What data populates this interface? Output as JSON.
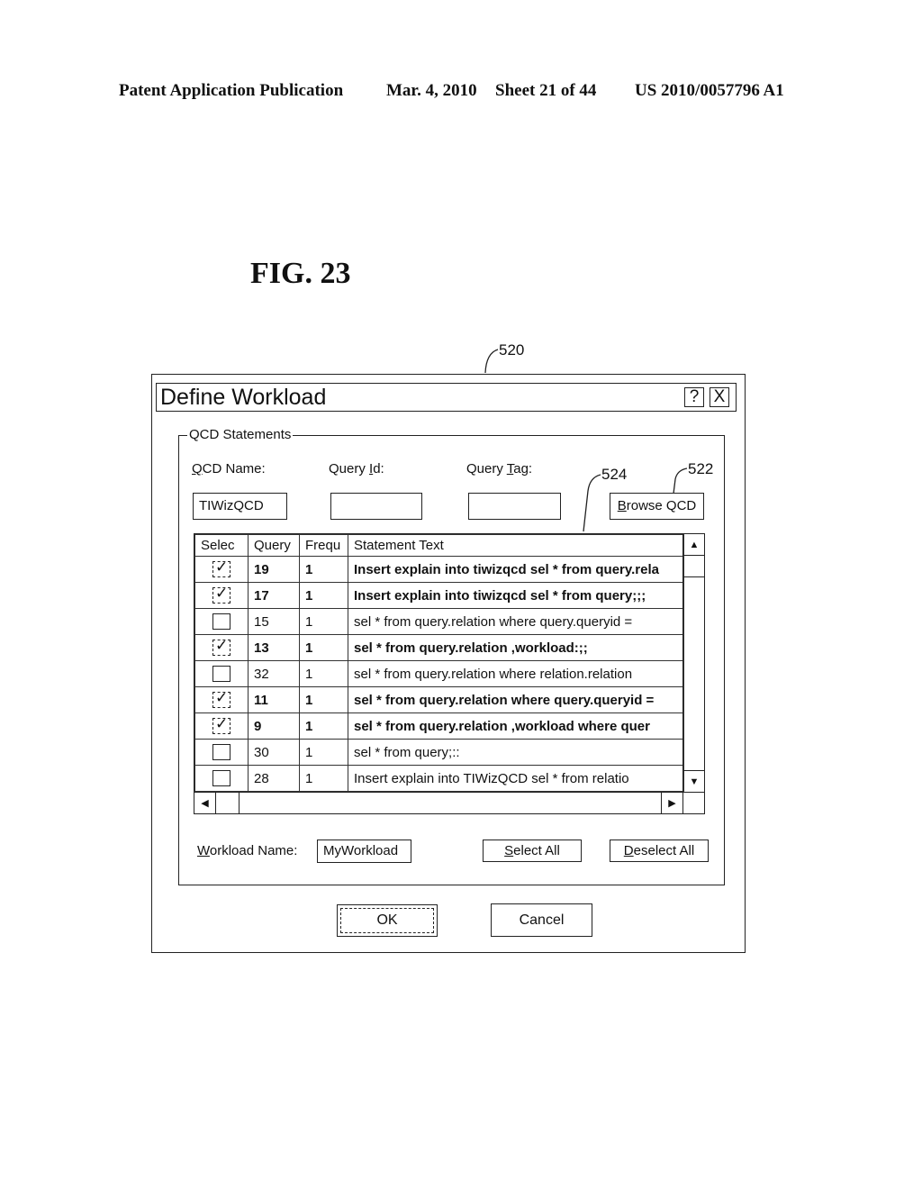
{
  "page_header": {
    "publication": "Patent Application Publication",
    "date": "Mar. 4, 2010",
    "sheet": "Sheet 21 of 44",
    "number": "US 2010/0057796 A1"
  },
  "figure_label": "FIG. 23",
  "reference_numerals": {
    "dialog": "520",
    "browse_button": "522",
    "grid": "524"
  },
  "dialog": {
    "title": "Define Workload",
    "help_button": "?",
    "close_button": "X",
    "group_label": "QCD Statements",
    "qcd_name": {
      "label_mnemonic": "Q",
      "label_rest": "CD Name:",
      "value": "TIWizQCD"
    },
    "query_id": {
      "label_pre": "Query ",
      "label_mnemonic": "I",
      "label_rest": "d:",
      "value": ""
    },
    "query_tag": {
      "label_pre": "Query ",
      "label_mnemonic": "T",
      "label_rest": "ag:",
      "value": ""
    },
    "browse_button": {
      "mnemonic": "B",
      "rest": "rowse QCD"
    },
    "grid": {
      "columns": [
        "Selec",
        "Query",
        "Frequ",
        "Statement Text"
      ],
      "rows": [
        {
          "selected": true,
          "query": "19",
          "freq": "1",
          "text": "Insert explain into tiwizqcd sel * from query.rela"
        },
        {
          "selected": true,
          "query": "17",
          "freq": "1",
          "text": "Insert explain into tiwizqcd sel * from query;;;"
        },
        {
          "selected": false,
          "query": "15",
          "freq": "1",
          "text": "sel * from query.relation where query.queryid ="
        },
        {
          "selected": true,
          "query": "13",
          "freq": "1",
          "text": "sel * from query.relation ,workload:;;"
        },
        {
          "selected": false,
          "query": "32",
          "freq": "1",
          "text": "sel * from query.relation where relation.relation"
        },
        {
          "selected": true,
          "query": "11",
          "freq": "1",
          "text": "sel * from query.relation where query.queryid ="
        },
        {
          "selected": true,
          "query": "9",
          "freq": "1",
          "text": "sel * from query.relation ,workload where quer"
        },
        {
          "selected": false,
          "query": "30",
          "freq": "1",
          "text": "sel * from query;::"
        },
        {
          "selected": false,
          "query": "28",
          "freq": "1",
          "text": "Insert explain into TIWizQCD sel * from relatio"
        }
      ]
    },
    "workload_name": {
      "label_mnemonic": "W",
      "label_rest": "orkload Name:",
      "value": "MyWorkload"
    },
    "select_all": {
      "mnemonic": "S",
      "rest": "elect All"
    },
    "deselect_all": {
      "mnemonic": "D",
      "rest": "eselect All"
    },
    "ok_button": "OK",
    "cancel_button": "Cancel"
  }
}
